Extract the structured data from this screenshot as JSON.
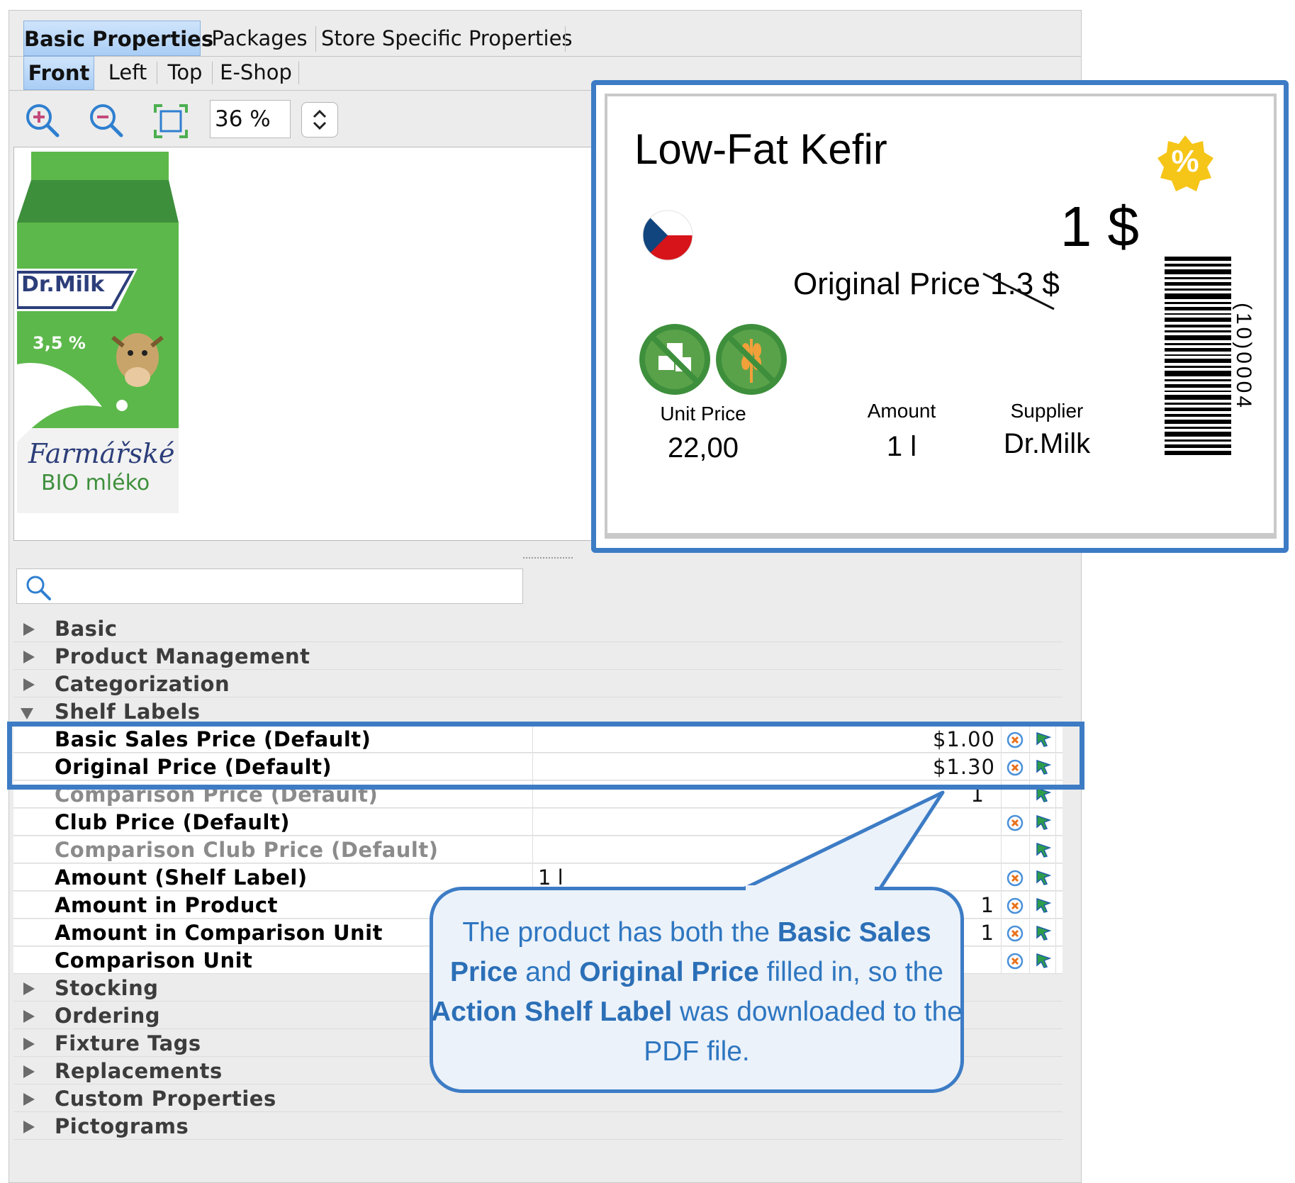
{
  "tabs_top": [
    {
      "label": "Basic Properties",
      "selected": true
    },
    {
      "label": "Packages",
      "selected": false
    },
    {
      "label": "Store Specific Properties",
      "selected": false
    }
  ],
  "tabs_view": [
    {
      "label": "Front",
      "selected": true
    },
    {
      "label": "Left",
      "selected": false
    },
    {
      "label": "Top",
      "selected": false
    },
    {
      "label": "E-Shop",
      "selected": false
    }
  ],
  "toolbar": {
    "zoom_in_icon": "zoom-in-icon",
    "zoom_out_icon": "zoom-out-icon",
    "fit_icon": "fit-to-screen-icon",
    "zoom_value": "36 %"
  },
  "product_image": {
    "brand": "Dr.Milk",
    "fat": "3,5 %",
    "line1": "Farmářské",
    "line2": "BIO mléko"
  },
  "search": {
    "placeholder": ""
  },
  "tree": {
    "categories_before": [
      {
        "label": "Basic"
      },
      {
        "label": "Product Management"
      },
      {
        "label": "Categorization"
      }
    ],
    "open_category": {
      "label": "Shelf Labels"
    },
    "properties": [
      {
        "label": "Basic Sales Price (Default)",
        "value": "$1.00",
        "dim": false
      },
      {
        "label": "Original Price (Default)",
        "value": "$1.30",
        "dim": false
      },
      {
        "label": "Comparison Price (Default)",
        "value": "1",
        "dim": true
      },
      {
        "label": "Club Price (Default)",
        "value": "",
        "dim": false
      },
      {
        "label": "Comparison Club Price (Default)",
        "value": "",
        "dim": true
      },
      {
        "label": "Amount (Shelf Label)",
        "value": "1 l",
        "dim": false
      },
      {
        "label": "Amount in Product",
        "value": "1",
        "dim": false
      },
      {
        "label": "Amount in Comparison Unit",
        "value": "1",
        "dim": false
      },
      {
        "label": "Comparison Unit",
        "value": "",
        "dim": false
      }
    ],
    "categories_after": [
      {
        "label": "Stocking"
      },
      {
        "label": "Ordering"
      },
      {
        "label": "Fixture Tags"
      },
      {
        "label": "Replacements"
      },
      {
        "label": "Custom Properties"
      },
      {
        "label": "Pictograms"
      }
    ]
  },
  "shelf_label": {
    "product_name": "Low-Fat Kefir",
    "badge": "%",
    "price": "1 $",
    "original_price_label": "Original Price",
    "original_price_value": "1.3 $",
    "unit_price_label": "Unit Price",
    "unit_price_value": "22,00",
    "amount_label": "Amount",
    "amount_value": "1 l",
    "supplier_label": "Supplier",
    "supplier_value": "Dr.Milk",
    "barcode_text": "(10)0004",
    "flag": "czech-flag",
    "pictograms": [
      "no-sugar-icon",
      "gluten-free-icon"
    ]
  },
  "callout": {
    "t1": "The product has both the ",
    "b1": "Basic Sales Price",
    "t2": " and ",
    "b2": "Original Price",
    "t3": " filled in, so the ",
    "b3": "Action Shelf Label",
    "t4": " was downloaded to the PDF file."
  },
  "colors": {
    "highlight": "#3d7cc5",
    "callout_text": "#2e76c0",
    "tab_selected": "#a9cdf5",
    "carton_green": "#5cb84a",
    "badge_yellow": "#f5c518"
  }
}
